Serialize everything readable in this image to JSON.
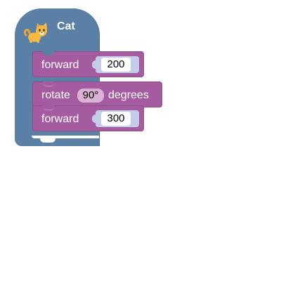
{
  "sprite": {
    "name": "Cat",
    "icon": "cat-icon",
    "color": "#5b80a5"
  },
  "blocks": [
    {
      "command": "forward",
      "value": "200",
      "color": "#a55b9f"
    },
    {
      "command": "rotate",
      "value": "90°",
      "suffix": "degrees",
      "color": "#a55b9f"
    },
    {
      "command": "forward",
      "value": "300",
      "color": "#a55b9f"
    }
  ]
}
